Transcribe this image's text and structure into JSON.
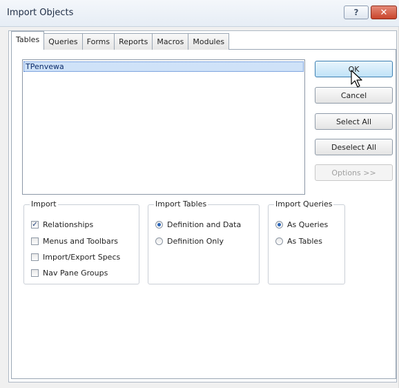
{
  "window": {
    "title": "Import Objects",
    "help_glyph": "?",
    "close_glyph": "✕"
  },
  "tabs": [
    "Tables",
    "Queries",
    "Forms",
    "Reports",
    "Macros",
    "Modules"
  ],
  "list": {
    "items": [
      "TPenvewa"
    ]
  },
  "buttons": {
    "ok": "OK",
    "cancel": "Cancel",
    "select_all": "Select All",
    "deselect_all": "Deselect All",
    "options": "Options >>"
  },
  "import_group": {
    "label": "Import",
    "options": [
      {
        "label": "Relationships",
        "checked": true
      },
      {
        "label": "Menus and Toolbars",
        "checked": false
      },
      {
        "label": "Import/Export Specs",
        "checked": false
      },
      {
        "label": "Nav Pane Groups",
        "checked": false
      }
    ]
  },
  "import_tables_group": {
    "label": "Import Tables",
    "options": [
      {
        "label": "Definition and Data",
        "selected": true
      },
      {
        "label": "Definition Only",
        "selected": false
      }
    ]
  },
  "import_queries_group": {
    "label": "Import Queries",
    "options": [
      {
        "label": "As Queries",
        "selected": true
      },
      {
        "label": "As Tables",
        "selected": false
      }
    ]
  },
  "colors": {
    "accent": "#2b65b8",
    "selection": "#cfe2f8",
    "close": "#c9452c"
  },
  "icons": {
    "help": "help-icon",
    "close": "close-icon",
    "cursor": "mouse-pointer-icon"
  }
}
